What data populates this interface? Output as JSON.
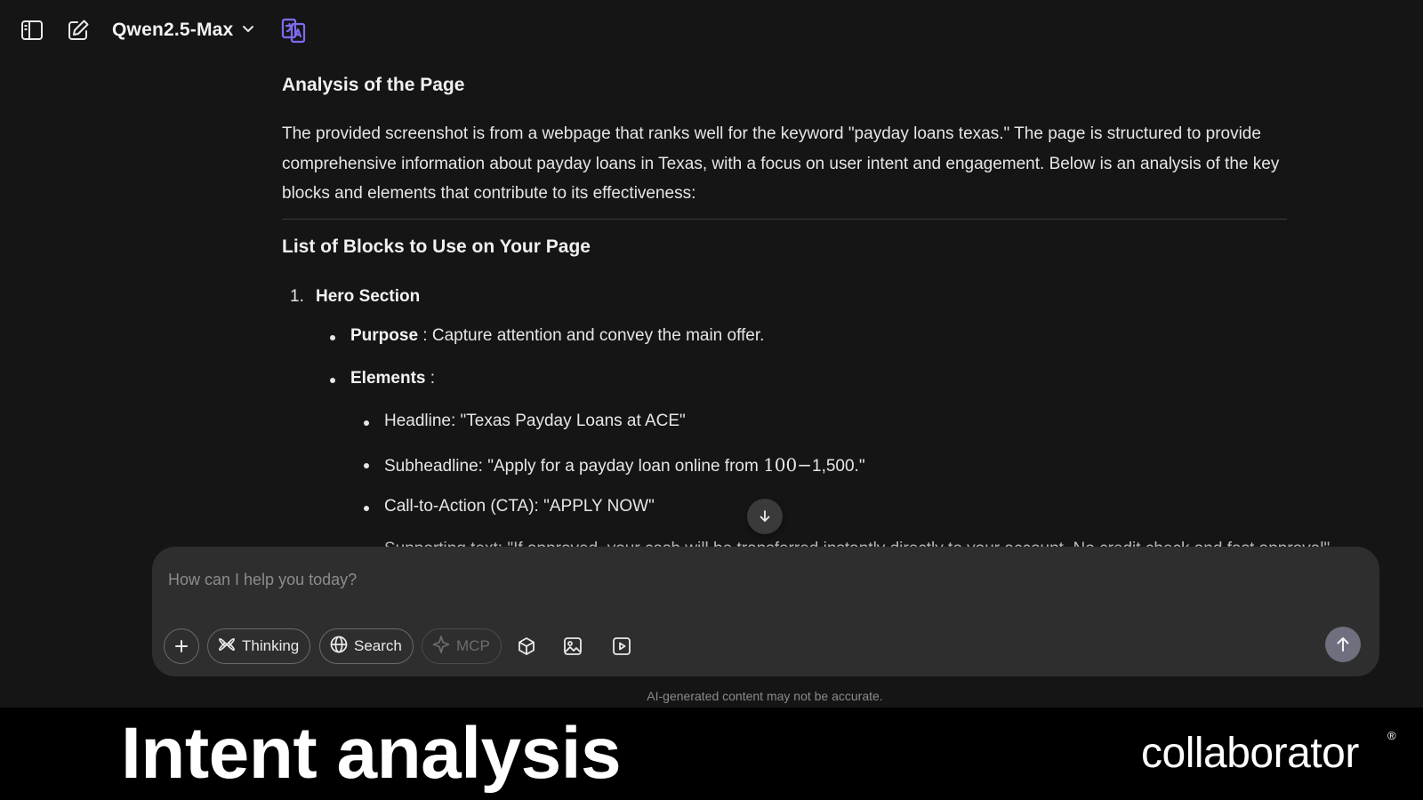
{
  "header": {
    "model_name": "Qwen2.5-Max",
    "icons": [
      "sidebar-toggle-icon",
      "new-chat-icon",
      "chevron-down-icon",
      "translate-icon"
    ],
    "accent_color": "#7b6cf0"
  },
  "message": {
    "heading": "Analysis of the Page",
    "intro": "The provided screenshot is from a webpage that ranks well for the keyword \"payday loans texas.\" The page is structured to provide comprehensive information about payday loans in Texas, with a focus on user intent and engagement. Below is an analysis of the key blocks and elements that contribute to its effectiveness:",
    "blocks_heading": "List of Blocks to Use on Your Page",
    "item1_number": "1.",
    "item1_title": "Hero Section",
    "purpose_label": "Purpose",
    "purpose_text": " : Capture attention and convey the main offer.",
    "elements_label": "Elements",
    "elements_suffix": " :",
    "element_1": "Headline: \"Texas Payday Loans at ACE\"",
    "element_2_prefix": "Subheadline: \"Apply for a payday loan online from ",
    "element_2_math": "100−",
    "element_2_suffix": "1,500.\"",
    "element_3": "Call-to-Action (CTA): \"APPLY NOW\"",
    "element_4_partial": "Supporting text: \"If approved, your cash will be transferred instantly directly to your account. No credit check and fast approval\""
  },
  "composer": {
    "placeholder": "How can I help you today?",
    "thinking_label": "Thinking",
    "search_label": "Search",
    "mcp_label": "MCP",
    "send_color": "#6e7080"
  },
  "disclaimer": "AI-generated content may not be accurate.",
  "caption": {
    "title": "Intent analysis",
    "brand": "collaborator",
    "brand_mark": "®"
  }
}
